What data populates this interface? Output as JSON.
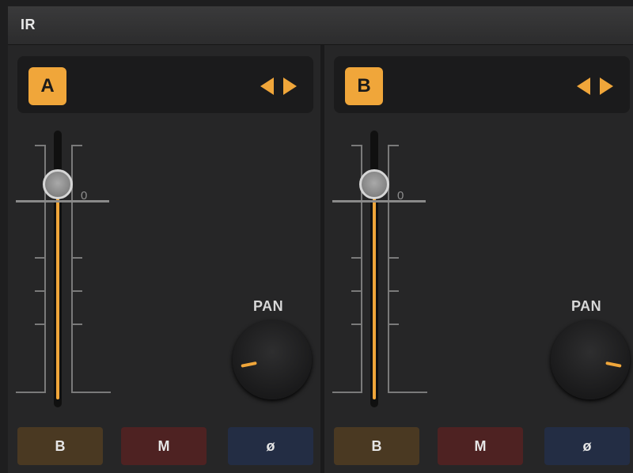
{
  "window": {
    "title": "IR"
  },
  "channels": [
    {
      "label": "A",
      "fader": {
        "zero_label": "0",
        "level": 0.8
      },
      "pan": {
        "label": "PAN",
        "value": -0.75
      },
      "buttons": {
        "bypass": "B",
        "mute": "M",
        "phase": "ø"
      }
    },
    {
      "label": "B",
      "fader": {
        "zero_label": "0",
        "level": 0.8
      },
      "pan": {
        "label": "PAN",
        "value": 0.75
      },
      "buttons": {
        "bypass": "B",
        "mute": "M",
        "phase": "ø"
      }
    }
  ],
  "colors": {
    "accent": "#f0a63a",
    "mute": "#4e2222",
    "bypass": "#4a3922",
    "phase": "#232d44"
  }
}
